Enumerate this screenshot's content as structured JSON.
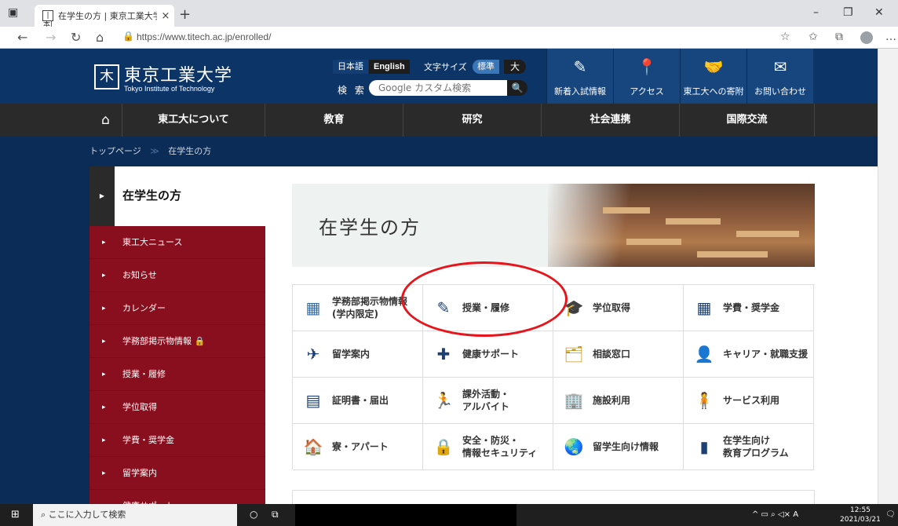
{
  "browser": {
    "tab_title": "在学生の方 | 東京工業大学",
    "tab_favicon": "|本|",
    "tab_close": "×",
    "new_tab": "+",
    "url": "https://www.titech.ac.jp/enrolled/",
    "window_controls": {
      "minimize": "–",
      "maximize": "❐",
      "close": "✕"
    }
  },
  "site": {
    "logo": {
      "jp": "東京工業大学",
      "en": "Tokyo Institute of Technology"
    },
    "header": {
      "lang_jp": "日本語",
      "lang_en": "English",
      "fontsize_label": "文字サイズ",
      "size_standard": "標準",
      "size_large": "大",
      "search_label": "検 索",
      "search_placeholder": "Google カスタム検索",
      "search_button": "🔍"
    },
    "quick_links": [
      {
        "icon": "✎",
        "label": "新着入試情報"
      },
      {
        "icon": "📍",
        "label": "アクセス"
      },
      {
        "icon": "🤝",
        "label": "東工大への寄附"
      },
      {
        "icon": "✉",
        "label": "お問い合わせ"
      }
    ],
    "global_nav": {
      "home_icon": "⌂",
      "items": [
        "東工大について",
        "教育",
        "研究",
        "社会連携",
        "国際交流"
      ]
    },
    "breadcrumb": {
      "home": "トップページ",
      "separator": "≫",
      "current": "在学生の方"
    },
    "sidebar": {
      "title": "在学生の方",
      "items": [
        "東工大ニュース",
        "お知らせ",
        "カレンダー",
        "学務部掲示物情報 🔒",
        "授業・履修",
        "学位取得",
        "学費・奨学金",
        "留学案内",
        "健康サポート"
      ]
    },
    "hero": {
      "title": "在学生の方"
    },
    "grid": [
      {
        "icon": "▦",
        "color": "#3a6ea8",
        "label": "学務部掲示物情報\n(学内限定)"
      },
      {
        "icon": "✎",
        "color": "#1d3f73",
        "label": "授業・履修"
      },
      {
        "icon": "🎓",
        "color": "#1d3f73",
        "label": "学位取得"
      },
      {
        "icon": "▦",
        "color": "#1d3f73",
        "label": "学費・奨学金"
      },
      {
        "icon": "✈",
        "color": "#1d3f73",
        "label": "留学案内"
      },
      {
        "icon": "✚",
        "color": "#1d3f73",
        "label": "健康サポート"
      },
      {
        "icon": "🗂",
        "color": "#1d3f73",
        "label": "相談窓口"
      },
      {
        "icon": "👤",
        "color": "#1d3f73",
        "label": "キャリア・就職支援"
      },
      {
        "icon": "▤",
        "color": "#1d3f73",
        "label": "証明書・届出"
      },
      {
        "icon": "🏃",
        "color": "#1d3f73",
        "label": "課外活動・\nアルバイト"
      },
      {
        "icon": "🏢",
        "color": "#1d3f73",
        "label": "施設利用"
      },
      {
        "icon": "🧍",
        "color": "#1d3f73",
        "label": "サービス利用"
      },
      {
        "icon": "🏠",
        "color": "#1d3f73",
        "label": "寮・アパート"
      },
      {
        "icon": "🔒",
        "color": "#1d3f73",
        "label": "安全・防災・\n情報セキュリティ"
      },
      {
        "icon": "🌏",
        "color": "#1d3f73",
        "label": "留学生向け情報"
      },
      {
        "icon": "▮",
        "color": "#1d3f73",
        "label": "在学生向け\n教育プログラム"
      }
    ]
  },
  "taskbar": {
    "start_icon": "⊞",
    "search_placeholder": "ここに入力して検索",
    "cortana_icon": "○",
    "taskview_icon": "⧉",
    "tray_icons": "^  ▭  ⌕  ◁×  A",
    "time": "12:55",
    "date": "2021/03/21"
  }
}
